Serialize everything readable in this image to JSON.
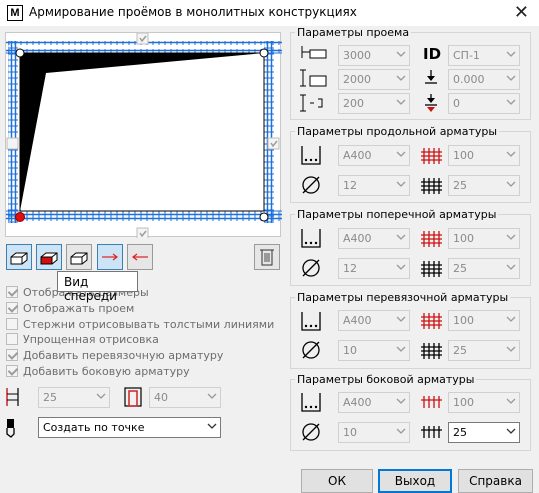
{
  "window": {
    "icon_letter": "M",
    "title": "Армирование проёмов в монолитных конструкциях",
    "close_glyph": "✕"
  },
  "toolbar": {
    "tooltip": "Вид спереди"
  },
  "options": {
    "show_sizes": "Отображать размеры",
    "show_opening": "Отображать проем",
    "thick_lines": "Стержни отрисовывать толстыми линиями",
    "simplified": "Упрощенная отрисовка",
    "add_tie": "Добавить перевязочную арматуру",
    "add_side": "Добавить боковую арматуру"
  },
  "bottom": {
    "value_a": "25",
    "value_b": "40",
    "create_mode": "Создать по точке"
  },
  "opening": {
    "title": "Параметры проема",
    "width": "3000",
    "height": "2000",
    "depth": "200",
    "id_label": "ID",
    "id_value": "СП-1",
    "level": "0.000",
    "offset": "0"
  },
  "long_rebar": {
    "title": "Параметры продольной арматуры",
    "class": "А400",
    "diameter": "12",
    "step_a": "100",
    "step_b": "25"
  },
  "trans_rebar": {
    "title": "Параметры поперечной арматуры",
    "class": "А400",
    "diameter": "12",
    "step_a": "100",
    "step_b": "25"
  },
  "tie_rebar": {
    "title": "Параметры перевязочной арматуры",
    "class": "А400",
    "diameter": "10",
    "step_a": "100",
    "step_b": "25"
  },
  "side_rebar": {
    "title": "Параметры боковой арматуры",
    "class": "А400",
    "diameter": "10",
    "step_a": "100",
    "step_b": "25"
  },
  "buttons": {
    "ok": "ОК",
    "exit": "Выход",
    "help": "Справка"
  },
  "colors": {
    "rebar_blue": "#1e6fd9",
    "rebar_red": "#cc1111"
  }
}
